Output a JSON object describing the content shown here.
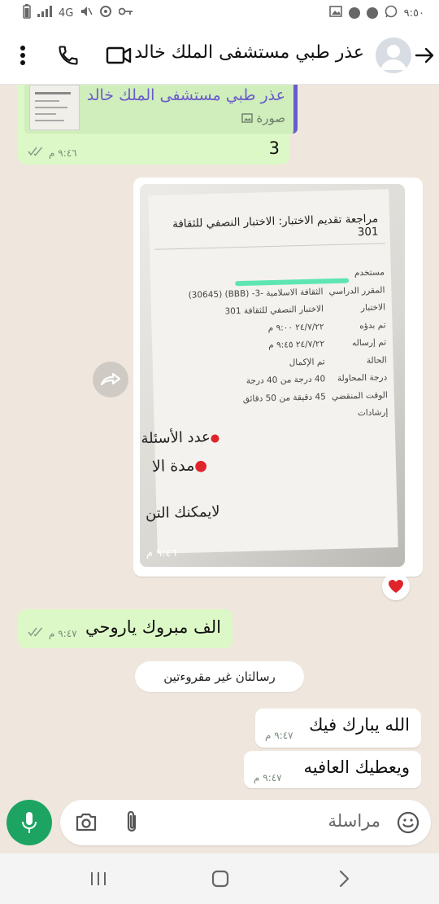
{
  "status_bar": {
    "signal": "4G",
    "time": "٩:٥٠"
  },
  "header": {
    "title": "عذر طبي مستشفى الملك خالد"
  },
  "messages": {
    "quoted_reply": {
      "quote_name": "عذر طبي مستشفى الملك خالد",
      "quote_type": "صورة",
      "text": "3",
      "time": "٩:٤٦ م"
    },
    "image_message": {
      "time": "٩:٤٦ م",
      "doc": {
        "title": "مراجعة تقديم الاختبار: الاختبار النصفي للثقافة 301",
        "rows": [
          {
            "label": "مستخدم",
            "value": ""
          },
          {
            "label": "المقرر الدراسي",
            "value": "الثقافة الاسلامية -3- (BBB) (30645)"
          },
          {
            "label": "الاختبار",
            "value": "الاختبار النصفي للثقافة 301"
          },
          {
            "label": "تم بدؤه",
            "value": "٢٤/٧/٢٢ ٩:٠٠ م"
          },
          {
            "label": "تم إرساله",
            "value": "٢٤/٧/٢٢ ٩:٤٥ م"
          },
          {
            "label": "الحالة",
            "value": "تم الإكمال"
          },
          {
            "label": "درجة المحاولة",
            "value": "40 درجة من 40 درجة"
          },
          {
            "label": "الوقت المنقضي",
            "value": "45 دقيقة من 50 دقائق"
          },
          {
            "label": "إرشادات",
            "value": ""
          }
        ],
        "line1": "عدد الأسئلة=",
        "line2": "مدة الا",
        "line3": "لايمكنك التن"
      }
    },
    "congrats": {
      "text": "الف مبروك ياروحي",
      "time": "٩:٤٧ م"
    },
    "unread_banner": "رسالتان غير مقروءتين",
    "reply1": {
      "text": "الله يبارك فيك",
      "time": "٩:٤٧ م"
    },
    "reply2": {
      "text": "ويعطيك العافيه",
      "time": "٩:٤٧ م"
    }
  },
  "composer": {
    "placeholder": "مراسلة"
  },
  "colors": {
    "out_bubble": "#dcf8c6",
    "in_bubble": "#ffffff",
    "mic": "#1da462",
    "chat_bg": "#efe7dd"
  }
}
